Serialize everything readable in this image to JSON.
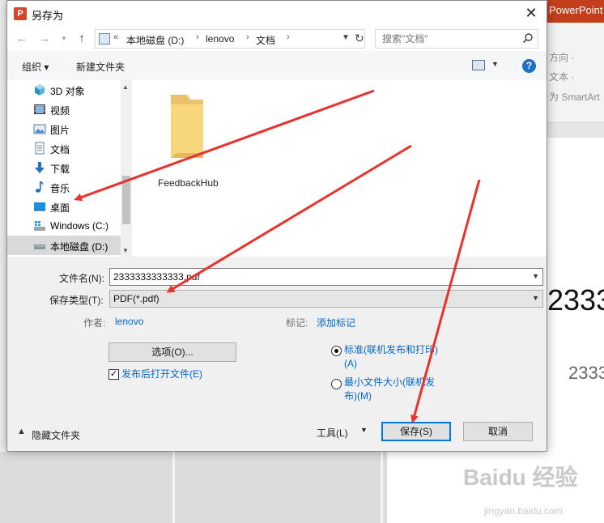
{
  "background_app": {
    "title_partial": "PowerPoint",
    "ribbon_items": [
      "方向 ·",
      "文本 ·",
      "为 SmartArt"
    ],
    "slide_title": "2333",
    "slide_subtitle": "2333",
    "watermark": "Baidu 经验",
    "watermark_url": "jingyan.baidu.com"
  },
  "dialog": {
    "title": "另存为",
    "close_symbol": "✕",
    "address": {
      "prefix": "«",
      "crumbs": [
        "本地磁盘 (D:)",
        "lenovo",
        "文档"
      ]
    },
    "search": {
      "placeholder": "搜索\"文档\""
    },
    "toolbar": {
      "organize": "组织 ▾",
      "new_folder": "新建文件夹"
    },
    "nav_items": [
      {
        "label": "3D 对象",
        "icon": "3d-objects-icon"
      },
      {
        "label": "视频",
        "icon": "video-icon"
      },
      {
        "label": "图片",
        "icon": "pictures-icon"
      },
      {
        "label": "文档",
        "icon": "documents-icon"
      },
      {
        "label": "下载",
        "icon": "download-icon"
      },
      {
        "label": "音乐",
        "icon": "music-icon"
      },
      {
        "label": "桌面",
        "icon": "desktop-icon"
      },
      {
        "label": "Windows (C:)",
        "icon": "drive-icon"
      },
      {
        "label": "本地磁盘 (D:)",
        "icon": "drive-icon",
        "selected": true
      }
    ],
    "files": [
      {
        "name": "FeedbackHub",
        "type": "folder"
      }
    ],
    "form": {
      "filename_label": "文件名(N):",
      "filename_value": "2333333333333.pdf",
      "type_label": "保存类型(T):",
      "type_value": "PDF(*.pdf)",
      "author_label": "作者:",
      "author_value": "lenovo",
      "tags_label": "标记:",
      "tags_value": "添加标记",
      "options_button": "选项(O)...",
      "open_after_publish": "发布后打开文件(E)",
      "open_after_checked": true,
      "opt_standard": "标准(联机发布和打印)(A)",
      "opt_standard_line1": "标准(联机发布和打印)",
      "opt_standard_line2": "(A)",
      "opt_minimum_line1": "最小文件大小(联机发",
      "opt_minimum_line2": "布)(M)",
      "selected_option": "standard"
    },
    "footer": {
      "hide_folders": "隐藏文件夹",
      "tools": "工具(L)",
      "save": "保存(S)",
      "cancel": "取消"
    }
  },
  "colors": {
    "accent": "#0078d7",
    "link": "#0066cc",
    "annotation_arrow": "#e8322d",
    "ppt_red": "#c43e1c"
  }
}
